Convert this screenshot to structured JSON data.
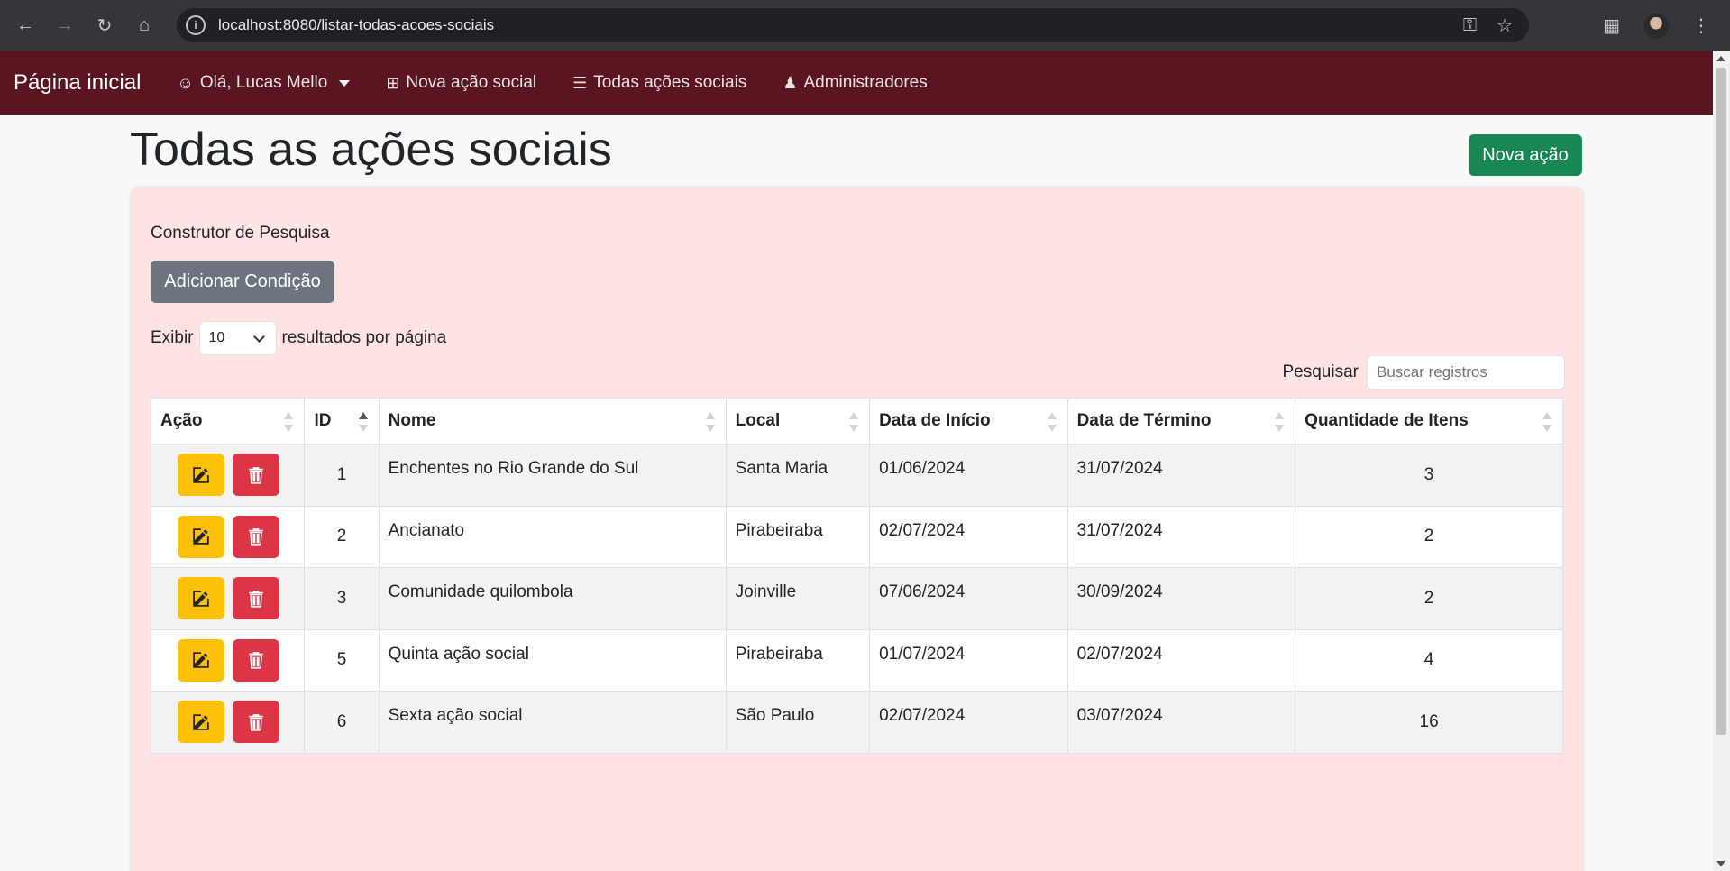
{
  "browser": {
    "url": "localhost:8080/listar-todas-acoes-sociais"
  },
  "navbar": {
    "brand": "Página inicial",
    "user_menu": "Olá, Lucas Mello",
    "items": [
      {
        "label": "Nova ação social",
        "icon": "plus-square-icon"
      },
      {
        "label": "Todas ações sociais",
        "icon": "list-icon"
      },
      {
        "label": "Administradores",
        "icon": "users-icon"
      }
    ]
  },
  "page": {
    "title": "Todas as ações sociais",
    "new_button": "Nova ação"
  },
  "builder": {
    "label": "Construtor de Pesquisa",
    "add_button": "Adicionar Condição"
  },
  "length": {
    "prefix": "Exibir",
    "value": "10",
    "suffix": "resultados por página"
  },
  "search": {
    "label": "Pesquisar",
    "placeholder": "Buscar registros"
  },
  "table": {
    "headers": [
      "Ação",
      "ID",
      "Nome",
      "Local",
      "Data de Início",
      "Data de Término",
      "Quantidade de Itens"
    ],
    "rows": [
      {
        "id": "1",
        "nome": "Enchentes no Rio Grande do Sul",
        "local": "Santa Maria",
        "inicio": "01/06/2024",
        "termino": "31/07/2024",
        "qtd": "3"
      },
      {
        "id": "2",
        "nome": "Ancianato",
        "local": "Pirabeiraba",
        "inicio": "02/07/2024",
        "termino": "31/07/2024",
        "qtd": "2"
      },
      {
        "id": "3",
        "nome": "Comunidade quilombola",
        "local": "Joinville",
        "inicio": "07/06/2024",
        "termino": "30/09/2024",
        "qtd": "2"
      },
      {
        "id": "5",
        "nome": "Quinta ação social",
        "local": "Pirabeiraba",
        "inicio": "01/07/2024",
        "termino": "02/07/2024",
        "qtd": "4"
      },
      {
        "id": "6",
        "nome": "Sexta ação social",
        "local": "São Paulo",
        "inicio": "02/07/2024",
        "termino": "03/07/2024",
        "qtd": "16"
      }
    ]
  },
  "colors": {
    "navbar": "#5a1520",
    "card": "#ffe3e3",
    "success": "#198754",
    "warning": "#ffc107",
    "danger": "#dc3545",
    "secondary": "#6c757d"
  }
}
